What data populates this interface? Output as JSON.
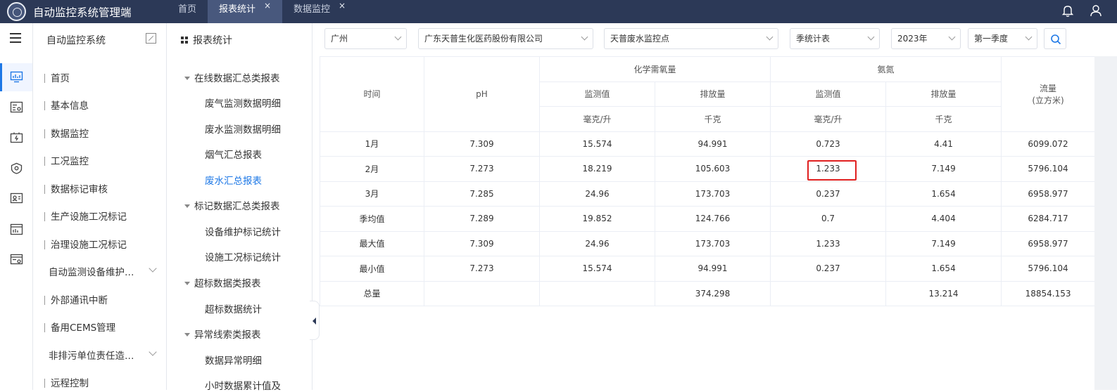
{
  "header": {
    "app_title": "自动监控系统管理端",
    "tabs": [
      {
        "label": "首页",
        "closable": false,
        "active": false
      },
      {
        "label": "报表统计",
        "closable": true,
        "active": true
      },
      {
        "label": "数据监控",
        "closable": true,
        "active": false
      }
    ],
    "close_glyph": "×",
    "icons": [
      "bell-icon",
      "user-icon"
    ]
  },
  "icon_strip": [
    "menu-icon",
    "monitor-icon",
    "config-icon",
    "battery-icon",
    "shield-icon",
    "dashboard-icon",
    "report-icon",
    "settings-card-icon"
  ],
  "menu": {
    "title": "自动监控系统",
    "items": [
      {
        "label": "首页",
        "has_bar": true,
        "expandable": false
      },
      {
        "label": "基本信息",
        "has_bar": true,
        "expandable": false
      },
      {
        "label": "数据监控",
        "has_bar": true,
        "expandable": false
      },
      {
        "label": "工况监控",
        "has_bar": true,
        "expandable": false
      },
      {
        "label": "数据标记审核",
        "has_bar": true,
        "expandable": false
      },
      {
        "label": "生产设施工况标记",
        "has_bar": true,
        "expandable": false
      },
      {
        "label": "治理设施工况标记",
        "has_bar": true,
        "expandable": false
      },
      {
        "label": "自动监测设备维护…",
        "has_bar": false,
        "expandable": true
      },
      {
        "label": "外部通讯中断",
        "has_bar": true,
        "expandable": false
      },
      {
        "label": "备用CEMS管理",
        "has_bar": true,
        "expandable": false
      },
      {
        "label": "非排污单位责任造…",
        "has_bar": false,
        "expandable": true
      },
      {
        "label": "远程控制",
        "has_bar": true,
        "expandable": false
      }
    ]
  },
  "tree": {
    "title": "报表统计",
    "groups": [
      {
        "label": "在线数据汇总类报表",
        "leaves": [
          "废气监测数据明细",
          "废水监测数据明细",
          "烟气汇总报表",
          "废水汇总报表"
        ]
      },
      {
        "label": "标记数据汇总类报表",
        "leaves": [
          "设备维护标记统计",
          "设施工况标记统计"
        ]
      },
      {
        "label": "超标数据类报表",
        "leaves": [
          "超标数据统计"
        ]
      },
      {
        "label": "异常线索类报表",
        "leaves": [
          "数据异常明细",
          "小时数据累计值及"
        ]
      }
    ],
    "active_leaf": "废水汇总报表"
  },
  "filters": {
    "city": "广州",
    "company": "广东天普生化医药股份有限公司",
    "point": "天普废水监控点",
    "report_type": "季统计表",
    "year": "2023年",
    "quarter": "第一季度"
  },
  "table": {
    "headers": {
      "time": "时间",
      "ph": "pH",
      "cod_group": "化学需氧量",
      "nh3_group": "氨氮",
      "flow": "流量",
      "flow_unit": "(立方米)",
      "measured": "监测值",
      "discharge": "排放量",
      "unit_conc": "毫克/升",
      "unit_mass": "千克"
    },
    "rows": [
      {
        "time": "1月",
        "ph": "7.309",
        "cod_val": "15.574",
        "cod_dis": "94.991",
        "nh3_val": "0.723",
        "nh3_dis": "4.41",
        "flow": "6099.072"
      },
      {
        "time": "2月",
        "ph": "7.273",
        "cod_val": "18.219",
        "cod_dis": "105.603",
        "nh3_val": "1.233",
        "nh3_dis": "7.149",
        "flow": "5796.104"
      },
      {
        "time": "3月",
        "ph": "7.285",
        "cod_val": "24.96",
        "cod_dis": "173.703",
        "nh3_val": "0.237",
        "nh3_dis": "1.654",
        "flow": "6958.977"
      },
      {
        "time": "季均值",
        "ph": "7.289",
        "cod_val": "19.852",
        "cod_dis": "124.766",
        "nh3_val": "0.7",
        "nh3_dis": "4.404",
        "flow": "6284.717"
      },
      {
        "time": "最大值",
        "ph": "7.309",
        "cod_val": "24.96",
        "cod_dis": "173.703",
        "nh3_val": "1.233",
        "nh3_dis": "7.149",
        "flow": "6958.977"
      },
      {
        "time": "最小值",
        "ph": "7.273",
        "cod_val": "15.574",
        "cod_dis": "94.991",
        "nh3_val": "0.237",
        "nh3_dis": "1.654",
        "flow": "5796.104"
      },
      {
        "time": "总量",
        "ph": "",
        "cod_val": "",
        "cod_dis": "374.298",
        "nh3_val": "",
        "nh3_dis": "13.214",
        "flow": "18854.153"
      }
    ],
    "highlight_color": "#e02020"
  },
  "colors": {
    "topbar": "#2c3957",
    "accent": "#1e78e6"
  }
}
